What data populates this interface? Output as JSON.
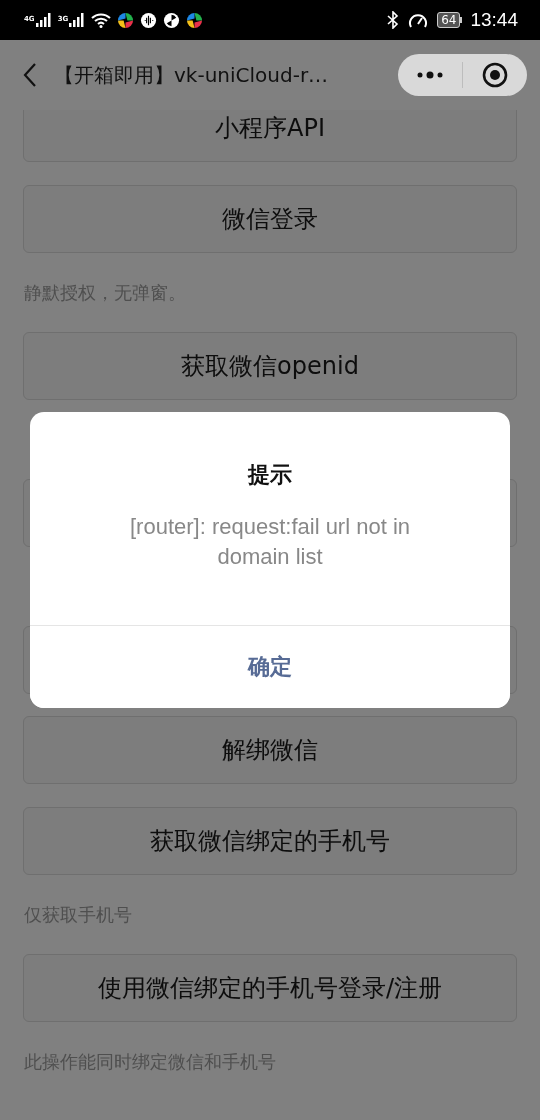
{
  "status_bar": {
    "networks": [
      {
        "label": "4G"
      },
      {
        "label": "3G"
      }
    ],
    "battery": "64",
    "time": "13:44"
  },
  "nav": {
    "title": "【开箱即用】vk-uniCloud-r…"
  },
  "content": [
    {
      "kind": "button",
      "label": "小程序API"
    },
    {
      "kind": "button",
      "label": "微信登录"
    },
    {
      "kind": "note",
      "text": "静默授权，无弹窗。"
    },
    {
      "kind": "button",
      "label": "获取微信openid"
    },
    {
      "kind": "covered_note"
    },
    {
      "kind": "covered_button"
    },
    {
      "kind": "covered_note"
    },
    {
      "kind": "covered_button"
    },
    {
      "kind": "button",
      "label": "解绑微信"
    },
    {
      "kind": "button",
      "label": "获取微信绑定的手机号"
    },
    {
      "kind": "note",
      "text": "仅获取手机号"
    },
    {
      "kind": "button",
      "label": "使用微信绑定的手机号登录/注册"
    },
    {
      "kind": "note",
      "text": "此操作能同时绑定微信和手机号"
    }
  ],
  "dialog": {
    "title": "提示",
    "message": "[router]: request:fail url not in domain list",
    "button": "确定"
  }
}
